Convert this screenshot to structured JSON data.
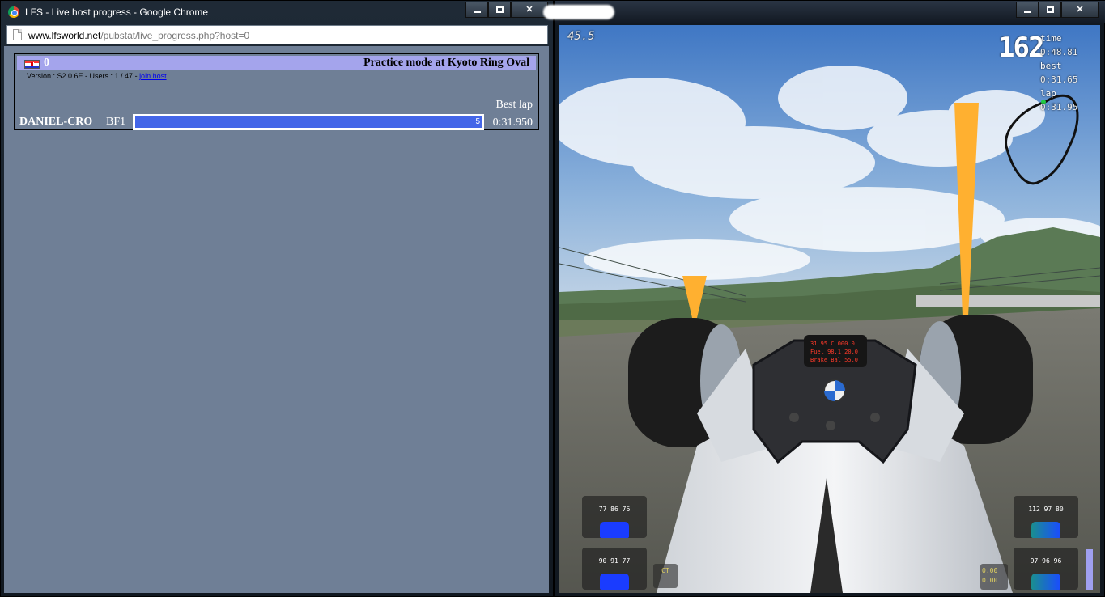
{
  "browser": {
    "title": "LFS - Live host progress - Google Chrome",
    "url_host": "www.lfsworld.net",
    "url_path": "/pubstat/live_progress.php?host=0"
  },
  "host": {
    "number": "0",
    "mode_title": "Practice mode at Kyoto Ring Oval",
    "version_text": "Version : S2 0.6E - Users : 1 / 47 - ",
    "join_link": "join host",
    "best_lap_header": "Best lap",
    "players": [
      {
        "name": "DANIEL-CRO",
        "car": "BF1",
        "laps": "5",
        "progress": 1.0,
        "best_lap": "0:31.950"
      }
    ]
  },
  "game_hud": {
    "fps": "45.5",
    "speed": "162",
    "time_label": "time",
    "time_value": "0:48.81",
    "best_label": "best",
    "best_value": "0:31.65",
    "lap_label": "lap",
    "lap_value": "0:31.95",
    "tyres": {
      "front_left": "77 86 76",
      "front_right": "112 97 80",
      "rear_left": "90 91 77",
      "rear_right": "97 96 96"
    },
    "ct_label": "CT",
    "small_values": [
      "0.00",
      "0.00"
    ]
  },
  "colors": {
    "page_bg": "#6f7f96",
    "header_bg": "#a4a4ec",
    "progress": "#4466e8",
    "cone": "#ffb030"
  }
}
